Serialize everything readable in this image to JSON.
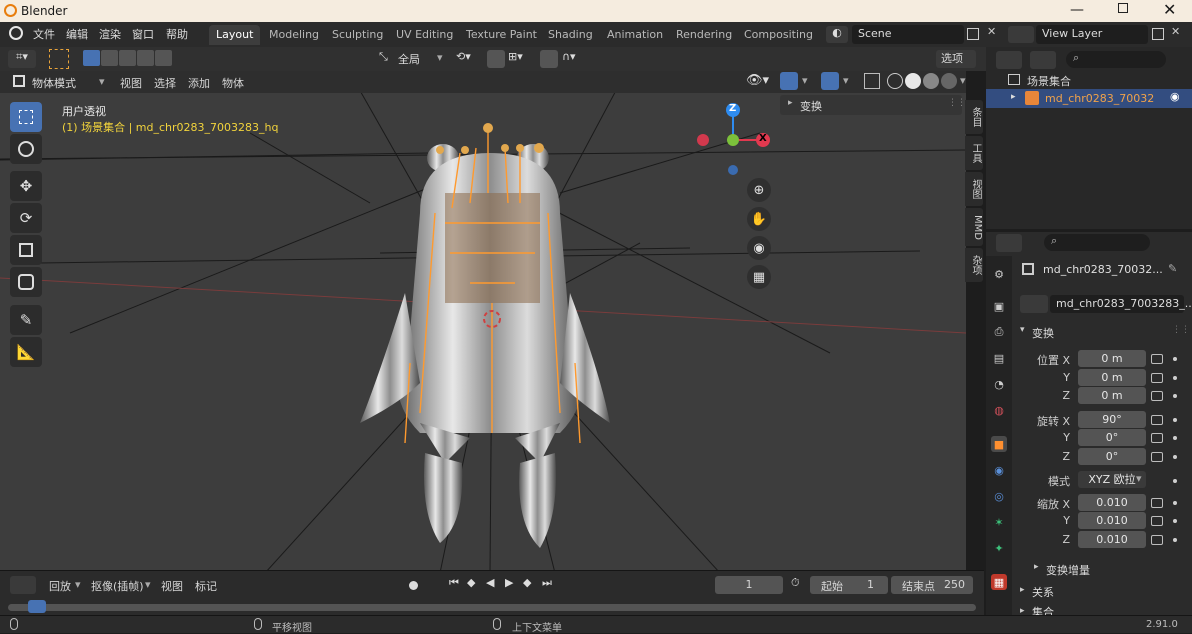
{
  "window": {
    "title": "Blender"
  },
  "menu": {
    "items": [
      "文件",
      "编辑",
      "渲染",
      "窗口",
      "帮助"
    ]
  },
  "workspaces": [
    "Layout",
    "Modeling",
    "Sculpting",
    "UV Editing",
    "Texture Paint",
    "Shading",
    "Animation",
    "Rendering",
    "Compositing"
  ],
  "scene": {
    "name": "Scene",
    "view_layer": "View Layer"
  },
  "viewport_header": {
    "mode": "物体模式",
    "menus": [
      "视图",
      "选择",
      "添加",
      "物体"
    ],
    "orientation": "全局",
    "options": "选项"
  },
  "viewport": {
    "view_name": "用户透视",
    "collection_info": "(1) 场景集合 | md_chr0283_7003283_hq",
    "sidebar_panel": "变换",
    "side_tabs": [
      "条目",
      "工具",
      "视图",
      "MMD",
      "杂项"
    ]
  },
  "gizmo": {
    "z": "Z",
    "x": "X"
  },
  "outliner": {
    "collection": "场景集合",
    "object": "md_chr0283_70032"
  },
  "properties": {
    "object_name": "md_chr0283_70032...",
    "data_name": "md_chr0283_7003283_...",
    "transform_title": "变换",
    "location_label": "位置 X",
    "rotation_label": "旋转 X",
    "scale_label": "缩放 X",
    "axis_y": "Y",
    "axis_z": "Z",
    "location": [
      "0 m",
      "0 m",
      "0 m"
    ],
    "rotation": [
      "90°",
      "0°",
      "0°"
    ],
    "mode_label": "模式",
    "mode_value": "XYZ 欧拉",
    "scale": [
      "0.010",
      "0.010",
      "0.010"
    ],
    "delta_transform": "变换增量",
    "relations": "关系",
    "collections": "集合"
  },
  "timeline": {
    "playback": "回放",
    "keying": "抠像(插帧)",
    "view": "视图",
    "marker": "标记",
    "current_frame": "1",
    "start_label": "起始",
    "start": "1",
    "end_label": "结束点",
    "end": "250"
  },
  "status": {
    "pan": "平移视图",
    "context_menu": "上下文菜单",
    "version": "2.91.0"
  },
  "colors": {
    "accent": "#4772b3",
    "orange": "#ff8c1a",
    "gizmo_x": "#e2394f",
    "gizmo_y": "#7cc13b",
    "gizmo_z": "#2e8cf0"
  }
}
